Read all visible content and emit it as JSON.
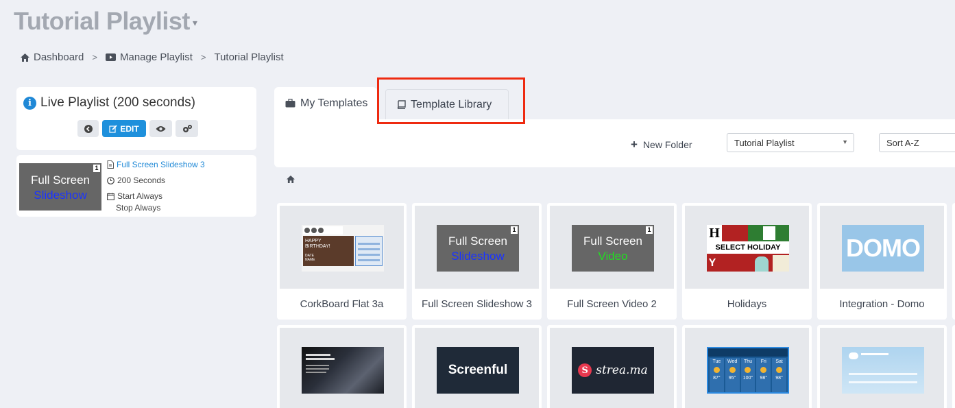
{
  "header": {
    "title": "Tutorial Playlist",
    "caret": "▾"
  },
  "breadcrumb": {
    "items": [
      "Dashboard",
      "Manage Playlist",
      "Tutorial Playlist"
    ],
    "separator": ">"
  },
  "live": {
    "title": "Live Playlist (200 seconds)",
    "edit_label": "EDIT",
    "item": {
      "thumb_line1": "Full Screen",
      "thumb_line2": "Slideshow",
      "badge": "1",
      "name": "Full Screen Slideshow 3",
      "duration": "200 Seconds",
      "start": "Start Always",
      "stop": "Stop Always"
    }
  },
  "tabs": {
    "my": "My Templates",
    "library": "Template Library"
  },
  "toolbar": {
    "new_folder": "New Folder",
    "folder_select": "Tutorial Playlist",
    "sort_select": "Sort A-Z"
  },
  "templates": [
    {
      "name": "CorkBoard Flat 3a"
    },
    {
      "name": "Full Screen Slideshow 3",
      "line1": "Full Screen",
      "line2": "Slideshow",
      "badge": "1"
    },
    {
      "name": "Full Screen Video 2",
      "line1": "Full Screen",
      "line2": "Video",
      "badge": "1"
    },
    {
      "name": "Holidays",
      "overlay": "SELECT HOLIDAY"
    },
    {
      "name": "Integration - Domo",
      "logo": "DOMO"
    },
    {
      "name": ""
    },
    {
      "name": "",
      "logo": "Screenful"
    },
    {
      "name": "",
      "logo": "strea.ma"
    },
    {
      "name": "",
      "days": [
        "Tue",
        "Wed",
        "Thu",
        "Fri",
        "Sat"
      ],
      "temps": [
        "87°",
        "95°",
        "100°",
        "98°",
        "98°"
      ]
    },
    {
      "name": ""
    }
  ],
  "colors": {
    "accent": "#1e90dc",
    "highlight": "#ee2a10",
    "thumb_gray": "#666666"
  }
}
